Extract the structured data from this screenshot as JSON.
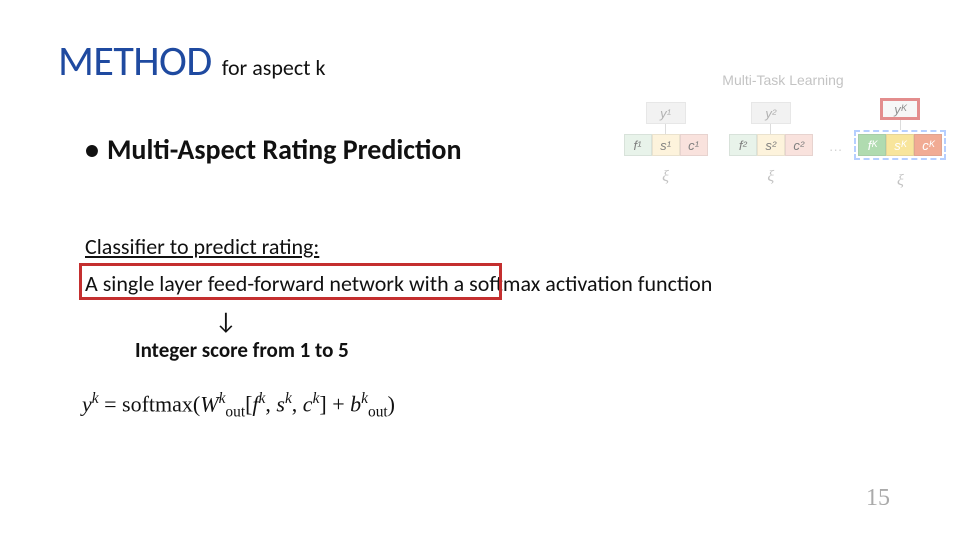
{
  "title": {
    "main": "METHOD",
    "sub": "for aspect k"
  },
  "bullet": "Multi-Aspect Rating Prediction",
  "classifier_label": "Classifier to predict rating:",
  "statement_a": "A single layer feed-forward network ",
  "statement_b": "with a softmax activation function",
  "arrow": "↓",
  "score_line": "Integer score from 1 to 5",
  "formula": {
    "y": "y",
    "k": "k",
    "eq": " = ",
    "softmax": "softmax",
    "lp": "(",
    "W": "W",
    "out": "out",
    "lb": "[",
    "f": "f",
    "com": ", ",
    "s": "s",
    "c": "c",
    "rb": "]",
    "plus": " + ",
    "b": "b",
    "rp": ")"
  },
  "page": "15",
  "diagram": {
    "title": "Multi-Task Learning",
    "y1": "y¹",
    "y2": "y²",
    "yK": "yᴷ",
    "f1": "f¹",
    "s1": "s¹",
    "c1": "c¹",
    "f2": "f²",
    "s2": "s²",
    "c2": "c²",
    "fK": "fᴷ",
    "sK": "sᴷ",
    "cK": "cᴷ",
    "dots": "…",
    "xi": "ξ"
  }
}
